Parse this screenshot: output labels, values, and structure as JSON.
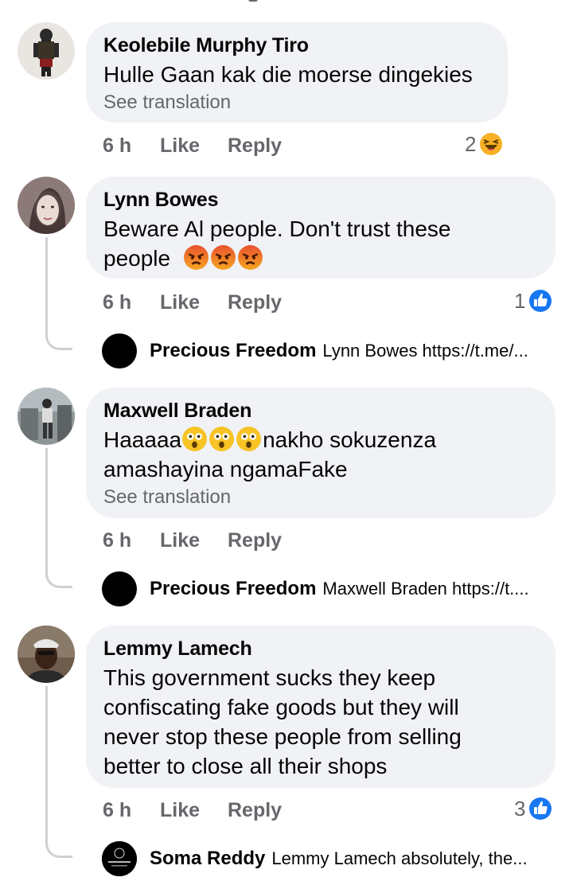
{
  "comments": [
    {
      "author": "Keolebile Murphy Tiro",
      "text": "Hulle Gaan kak die moerse dingekies",
      "see_translation": "See translation",
      "time": "6 h",
      "like": "Like",
      "reply": "Reply",
      "reaction_count": "2",
      "reaction_icon": "haha-icon"
    },
    {
      "author": "Lynn Bowes",
      "text_line1": "Beware Al people. Don't trust these",
      "text_line2": "people",
      "emoji": "angry-face-icon",
      "time": "6 h",
      "like": "Like",
      "reply": "Reply",
      "reaction_count": "1",
      "reaction_icon": "like-icon",
      "replies": [
        {
          "author": "Precious Freedom",
          "text": "Lynn Bowes https://t.me/..."
        }
      ]
    },
    {
      "author": "Maxwell Braden",
      "text_before": "Haaaaa",
      "emoji": "astonished-face-icon",
      "text_after": "nakho sokuzenza",
      "text_line2": "amashayina ngamaFake",
      "see_translation": "See translation",
      "time": "6 h",
      "like": "Like",
      "reply": "Reply",
      "replies": [
        {
          "author": "Precious Freedom",
          "text": "Maxwell Braden https://t...."
        }
      ]
    },
    {
      "author": "Lemmy Lamech",
      "lines": [
        "This government sucks they keep",
        "confiscating fake goods but they will",
        "never stop these people from selling",
        "better to close all their shops"
      ],
      "time": "6 h",
      "like": "Like",
      "reply": "Reply",
      "reaction_count": "3",
      "reaction_icon": "like-icon",
      "replies": [
        {
          "author": "Soma Reddy",
          "text": "Lemmy Lamech absolutely,  the..."
        }
      ]
    }
  ],
  "colors": {
    "bubble": "#f0f2f5",
    "secondary_text": "#65676b",
    "like_blue": "#1877f2",
    "thread_line": "#ced0d4"
  }
}
